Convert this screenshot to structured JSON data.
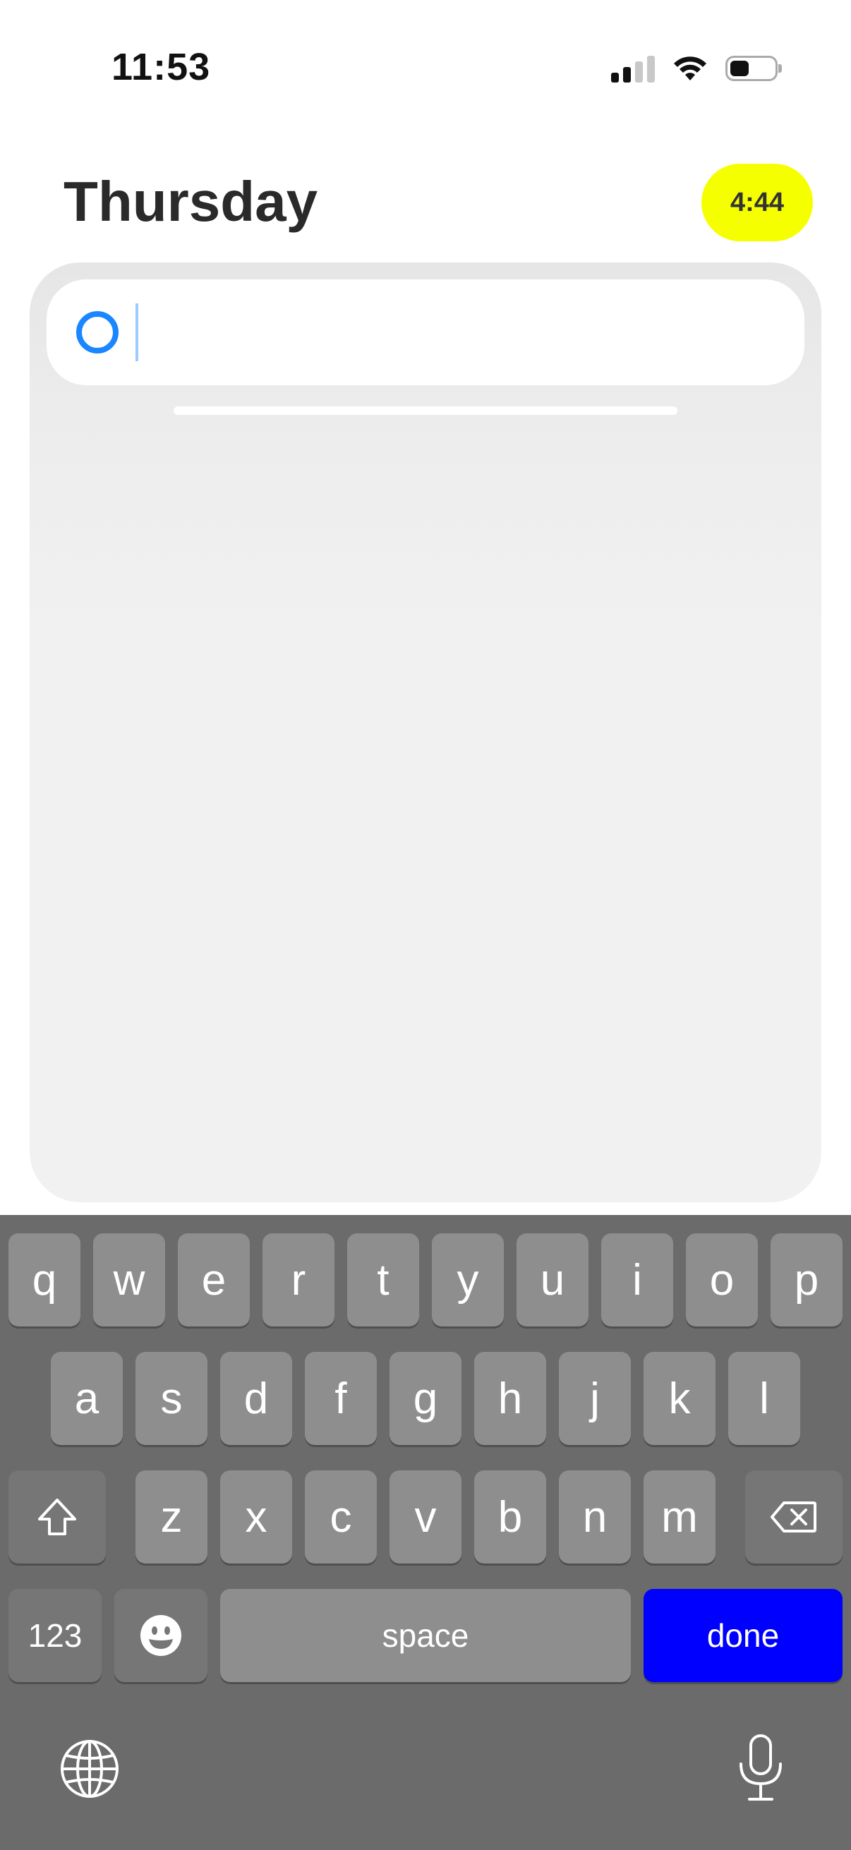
{
  "status_bar": {
    "time": "11:53"
  },
  "header": {
    "title": "Thursday",
    "timer": "4:44"
  },
  "task_input": {
    "value": "",
    "placeholder": ""
  },
  "keyboard": {
    "row1": [
      "q",
      "w",
      "e",
      "r",
      "t",
      "y",
      "u",
      "i",
      "o",
      "p"
    ],
    "row2": [
      "a",
      "s",
      "d",
      "f",
      "g",
      "h",
      "j",
      "k",
      "l"
    ],
    "row3": [
      "z",
      "x",
      "c",
      "v",
      "b",
      "n",
      "m"
    ],
    "numbers_label": "123",
    "space_label": "space",
    "done_label": "done"
  },
  "colors": {
    "timer_bg": "#f5ff00",
    "toggle_blue": "#1a86ff",
    "done_blue": "#0000ff",
    "keyboard_bg": "#6b6b6b"
  },
  "icons": [
    "signal-icon",
    "wifi-icon",
    "battery-icon",
    "shift-icon",
    "delete-icon",
    "emoji-icon",
    "globe-icon",
    "mic-icon"
  ]
}
